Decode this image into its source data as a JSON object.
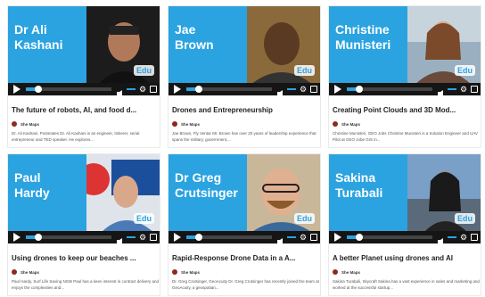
{
  "logo_text": "Edu",
  "accent_color": "#2aa3e0",
  "cards": [
    {
      "name": "Dr Ali\nKashani",
      "title": "The future of robots, AI, and food d...",
      "author": "She Maps",
      "desc": "Dr. Ali Kashani, Postmates Dr. Ali Kashani is an engineer, tinkerer, serial entrepreneur and TED speaker. He explores..."
    },
    {
      "name": "Jae\nBrown",
      "title": "Drones and Entrepreneurship",
      "author": "She Maps",
      "desc": "Jae Brown, Fly Ventar Mr. Brown has over 20 years of leadership experience that spans the military, government,..."
    },
    {
      "name": "Christine\nMunisteri",
      "title": "Creating Point Clouds and 3D Mod...",
      "author": "She Maps",
      "desc": "Christine Munisteri, GEO Jobs Christine Munisteri is a Solution Engineer and UAV Pilot at GEO Jobe GIS in..."
    },
    {
      "name": "Paul\nHardy",
      "title": "Using drones to keep our beaches ...",
      "author": "She Maps",
      "desc": "Paul Hardy, Surf Life Saving NSW Paul has a keen interest in contract delivery and enjoys the complexities and..."
    },
    {
      "name": "Dr Greg\nCrutsinger",
      "title": "Rapid-Response Drone Data in a A...",
      "author": "She Maps",
      "desc": "Dr. Greg Crutsinger, GeoAcuity Dr. Greg Crutsinger has recently joined the team at GeoAcuity, a geospatian..."
    },
    {
      "name": "Sakina\nTurabali",
      "title": "A better Planet using drones and AI",
      "author": "She Maps",
      "desc": "Sakina Turabali, Skycraft Sakina has a vast experience in sales and marketing and worked at the successful startup..."
    }
  ]
}
